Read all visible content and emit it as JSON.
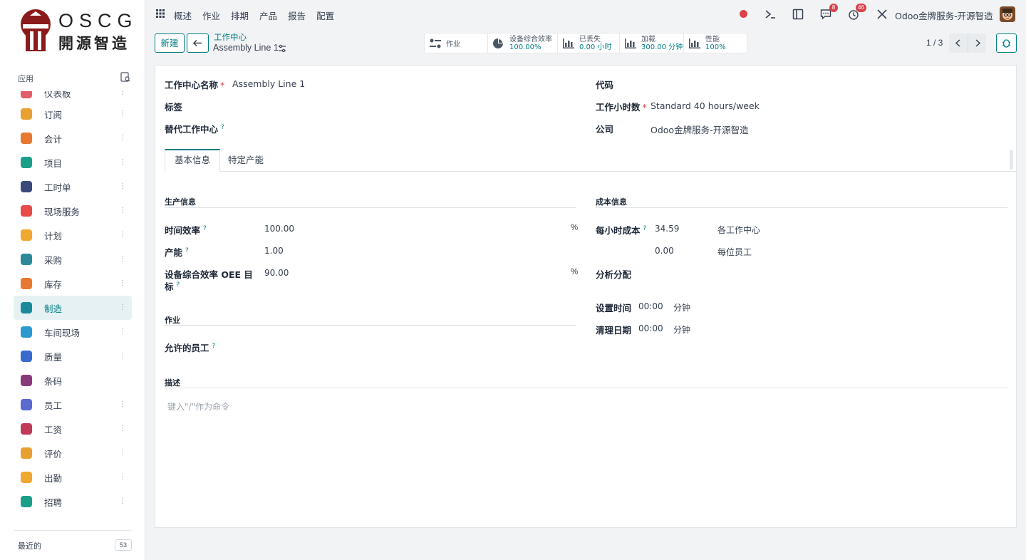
{
  "brand": {
    "top": "OSCG",
    "bottom": "開源智造"
  },
  "sidebar": {
    "header": "应用",
    "items": [
      {
        "label": "仪表板",
        "icon": "dashboard-icon",
        "color": "#e35d6a"
      },
      {
        "label": "订阅",
        "icon": "subscription-icon",
        "color": "#e8a030"
      },
      {
        "label": "会计",
        "icon": "accounting-icon",
        "color": "#e8782f"
      },
      {
        "label": "项目",
        "icon": "project-icon",
        "color": "#1aa08a"
      },
      {
        "label": "工时单",
        "icon": "timesheet-icon",
        "color": "#3a4a7a"
      },
      {
        "label": "现场服务",
        "icon": "field-service-icon",
        "color": "#e84a4a"
      },
      {
        "label": "计划",
        "icon": "planning-icon",
        "color": "#f0a830"
      },
      {
        "label": "采购",
        "icon": "purchase-icon",
        "color": "#2a8a9a"
      },
      {
        "label": "库存",
        "icon": "inventory-icon",
        "color": "#e8782f"
      },
      {
        "label": "制造",
        "icon": "manufacturing-icon",
        "color": "#1a8a9a"
      },
      {
        "label": "车间现场",
        "icon": "shop-floor-icon",
        "color": "#2a9ad0"
      },
      {
        "label": "质量",
        "icon": "quality-icon",
        "color": "#3a6ad0"
      },
      {
        "label": "条码",
        "icon": "barcode-icon",
        "color": "#8a3a7a"
      },
      {
        "label": "员工",
        "icon": "employees-icon",
        "color": "#5a6ad0"
      },
      {
        "label": "工资",
        "icon": "payroll-icon",
        "color": "#c03a5a"
      },
      {
        "label": "评价",
        "icon": "appraisal-icon",
        "color": "#e8a030"
      },
      {
        "label": "出勤",
        "icon": "attendance-icon",
        "color": "#f0a830"
      },
      {
        "label": "招聘",
        "icon": "recruitment-icon",
        "color": "#1aa08a"
      }
    ],
    "active_index": 9,
    "recent_label": "最近的",
    "recent_count": "53"
  },
  "topnav": {
    "menu": [
      "概述",
      "作业",
      "排期",
      "产品",
      "报告",
      "配置"
    ],
    "messages_badge": "8",
    "activities_badge": "46",
    "company": "Odoo金牌服务-开源智造"
  },
  "control": {
    "new_label": "新建",
    "breadcrumb_parent": "工作中心",
    "breadcrumb_current": "Assembly Line 1",
    "stats": [
      {
        "label": "作业",
        "value": "",
        "icon": "operations-icon"
      },
      {
        "label": "设备综合效率",
        "value": "100.00%",
        "icon": "pie-chart-icon"
      },
      {
        "label": "已丢失",
        "value": "0.00 小时",
        "icon": "bar-chart-icon"
      },
      {
        "label": "加载",
        "value": "300.00 分钟",
        "icon": "bar-chart-icon"
      },
      {
        "label": "性能",
        "value": "100%",
        "icon": "bar-chart-icon"
      }
    ],
    "pager": "1 / 3"
  },
  "form": {
    "name_label": "工作中心名称",
    "name_value": "Assembly Line 1",
    "tags_label": "标签",
    "alt_label": "替代工作中心",
    "code_label": "代码",
    "hours_label": "工作小时数",
    "hours_value": "Standard 40 hours/week",
    "company_label": "公司",
    "company_value": "Odoo金牌服务-开源智造",
    "tabs": [
      "基本信息",
      "特定产能"
    ],
    "production": {
      "title": "生产信息",
      "time_eff_label": "时间效率",
      "time_eff_value": "100.00",
      "capacity_label": "产能",
      "capacity_value": "1.00",
      "oee_label_1": "设备综合效率 OEE 目",
      "oee_label_2": "标",
      "oee_value": "90.00",
      "percent": "%"
    },
    "cost": {
      "title": "成本信息",
      "hourly_label": "每小时成本",
      "hourly_value": "34.59",
      "hourly_unit": "各工作中心",
      "employee_value": "0.00",
      "employee_unit": "每位员工",
      "analytic_label": "分析分配",
      "setup_label": "设置时间",
      "setup_value": "00:00",
      "setup_unit": "分钟",
      "cleanup_label": "清理日期",
      "cleanup_value": "00:00",
      "cleanup_unit": "分钟"
    },
    "operations": {
      "title": "作业",
      "employees_label": "允许的员工"
    },
    "description": {
      "title": "描述",
      "placeholder": "键入\"/\"作为命令"
    }
  }
}
